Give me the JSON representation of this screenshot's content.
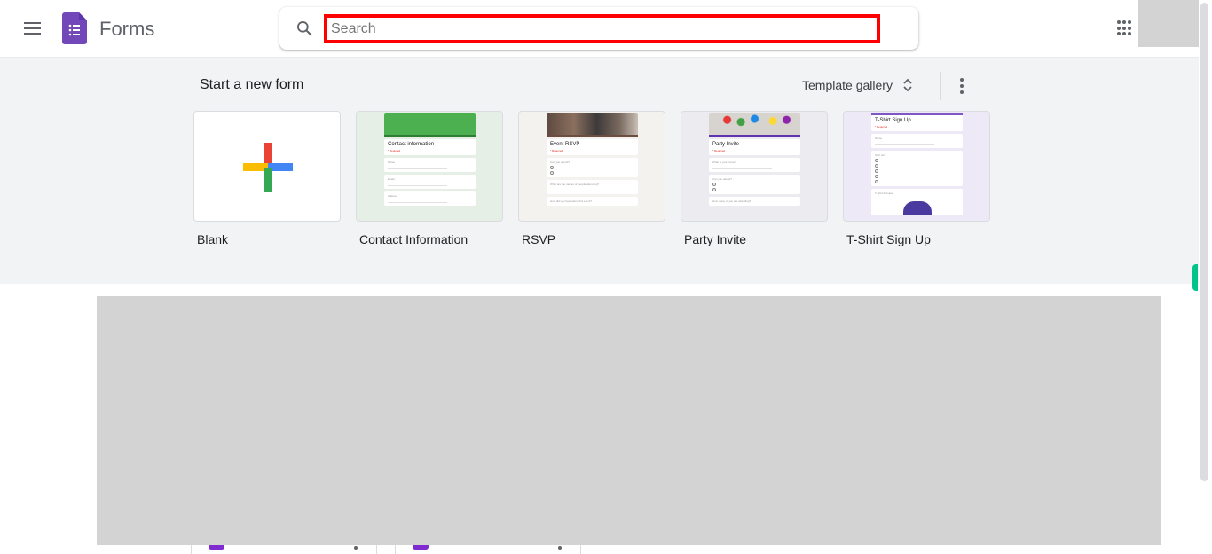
{
  "header": {
    "app_title": "Forms",
    "menu_icon": "hamburger-menu-icon",
    "logo_icon": "forms-logo-icon",
    "search": {
      "placeholder": "Search",
      "value": ""
    },
    "apps_icon": "google-apps-grid-icon"
  },
  "templates": {
    "section_title": "Start a new form",
    "gallery_label": "Template gallery",
    "more_icon": "more-vert-icon",
    "items": [
      {
        "label": "Blank",
        "icon": "plus-icon"
      },
      {
        "label": "Contact Information",
        "preview_title": "Contact information",
        "preview_fields": [
          "Name",
          "Email",
          "Address"
        ],
        "accent": "#4caf50"
      },
      {
        "label": "RSVP",
        "preview_title": "Event RSVP",
        "preview_fields": [
          "Can you attend?",
          "What are the names of people attending?",
          "How did you hear about this event?"
        ],
        "accent": "#6d4c41"
      },
      {
        "label": "Party Invite",
        "preview_title": "Party Invite",
        "preview_fields": [
          "What is your name?",
          "Can you attend?",
          "How many of you are attending?"
        ],
        "accent": "#673ab7"
      },
      {
        "label": "T-Shirt Sign Up",
        "preview_title": "T-Shirt Sign Up",
        "preview_fields": [
          "Name",
          "Shirt size",
          "T-Shirt Preview"
        ],
        "accent": "#7e57c2"
      }
    ]
  },
  "colors": {
    "band_bg": "#f1f3f4",
    "search_highlight": "#ff0000",
    "forms_purple": "#7248b9",
    "side_tab": "#00c58b"
  }
}
